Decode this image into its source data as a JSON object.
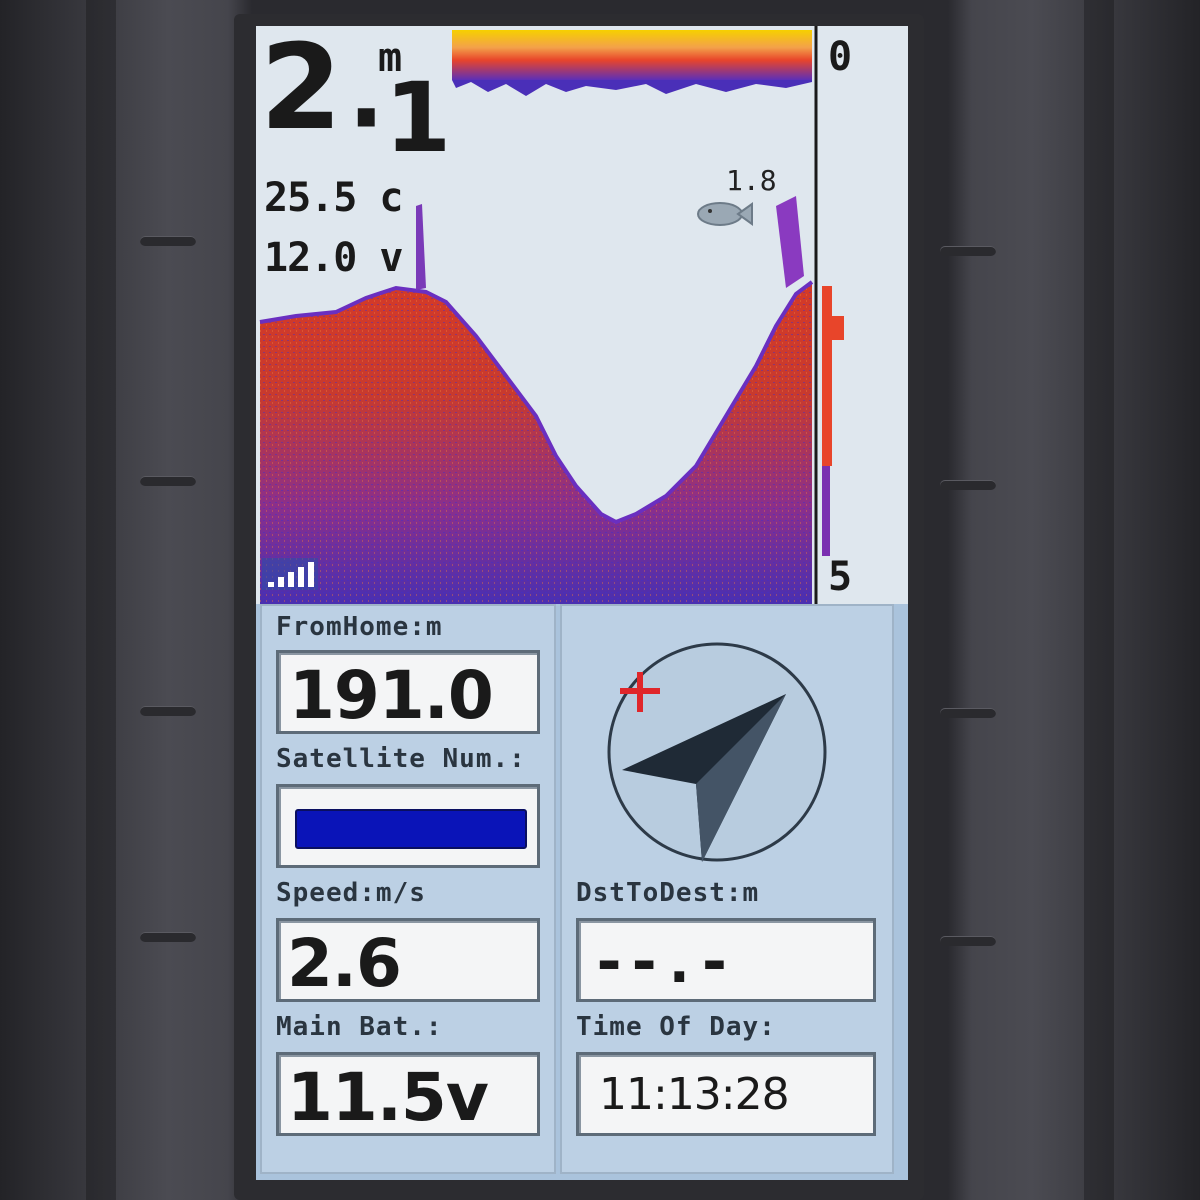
{
  "sonar": {
    "depth_int": "2",
    "depth_dot": "·1",
    "depth_unit": "m",
    "water_temp": "25.5 c",
    "supply_voltage": "12.0 v",
    "fish_depth_label": "1.8",
    "scale_top": "0",
    "scale_bottom": "5",
    "icons": {
      "fish": "fish-icon",
      "signal": "signal-strength-icon"
    },
    "colors": {
      "strong_return": "#e8452a",
      "weak_return": "#3b2fd0",
      "surface": "#f6d000",
      "background": "#dfe7ee"
    }
  },
  "panel": {
    "from_home": {
      "label": "FromHome:m",
      "value": "191.0"
    },
    "satellite": {
      "label": "Satellite Num.:",
      "bar_color": "#0a14b8"
    },
    "speed": {
      "label": "Speed:m/s",
      "value": "2.6"
    },
    "main_battery": {
      "label": "Main Bat.:",
      "value": "11.5v"
    },
    "dst_to_dest": {
      "label": "DstToDest:m",
      "value": "--.-"
    },
    "time_of_day": {
      "label": "Time Of Day:",
      "value": "11:13:28"
    },
    "compass": {
      "icon": "compass-arrow-icon",
      "home_marker": "home-cross-icon",
      "marker_color": "#e0262a"
    }
  }
}
